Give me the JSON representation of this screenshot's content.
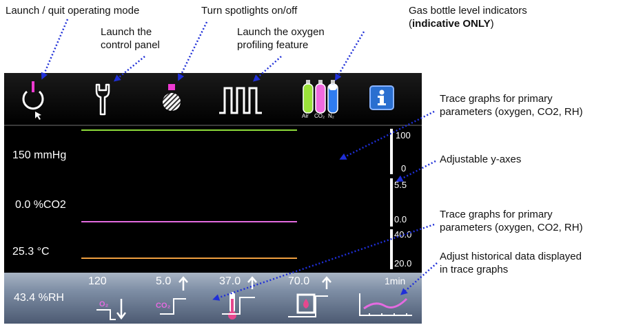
{
  "callouts": {
    "operating_mode": "Launch / quit operating mode",
    "control_panel_l1": "Launch the",
    "control_panel_l2": "control panel",
    "spotlights": "Turn spotlights on/off",
    "oxygen_l1": "Launch the oxygen",
    "oxygen_l2": "profiling feature",
    "gas_l1": "Gas bottle level indicators",
    "gas_l2_pre": "(",
    "gas_l2_bold": "indicative ONLY",
    "gas_l2_post": ")",
    "trace1_l1": "Trace graphs for primary",
    "trace1_l2": "parameters (oxygen, CO2, RH)",
    "yaxes": "Adjustable y-axes",
    "trace2_l1": "Trace graphs for primary",
    "trace2_l2": "parameters (oxygen, CO2, RH)",
    "history_l1": "Adjust historical data displayed",
    "history_l2": "in trace graphs"
  },
  "readouts": {
    "oxygen": "150 mmHg",
    "co2": "0.0 %CO2",
    "temperature": "25.3 °C",
    "humidity": "43.4 %RH"
  },
  "y_axes": {
    "oxygen_max": "100",
    "oxygen_min": "0",
    "co2_max": "5.5",
    "co2_min": "0.0",
    "temp_max": "40.0",
    "temp_min": "20.0"
  },
  "gas_bottles": {
    "air_label": "Air",
    "co2_label": "CO₂",
    "n2_label": "N₂",
    "air_color": "#9be23a",
    "co2_color": "#f06be0",
    "n2_color": "#2f7cf0"
  },
  "setpoints": {
    "oxygen_value": "120",
    "oxygen_unit": "O₂",
    "co2_value": "5.0",
    "co2_unit": "CO₂",
    "temp_value": "37.0",
    "humidity_value": "70.0",
    "history_value": "1min"
  },
  "colors": {
    "trace_oxygen": "#8edc3a",
    "trace_co2": "#e46be0",
    "trace_temp": "#f0a040",
    "callout_arrow": "#1f2fd8",
    "power_accent": "#ee3ad2",
    "info_button": "#2a6fd0"
  },
  "icons": {
    "power": "power-icon",
    "wrench": "wrench-icon",
    "spotlight": "spotlight-icon",
    "oxygen_profile": "square-wave-icon",
    "gas": "gas-bottle-icon",
    "info": "info-icon"
  }
}
